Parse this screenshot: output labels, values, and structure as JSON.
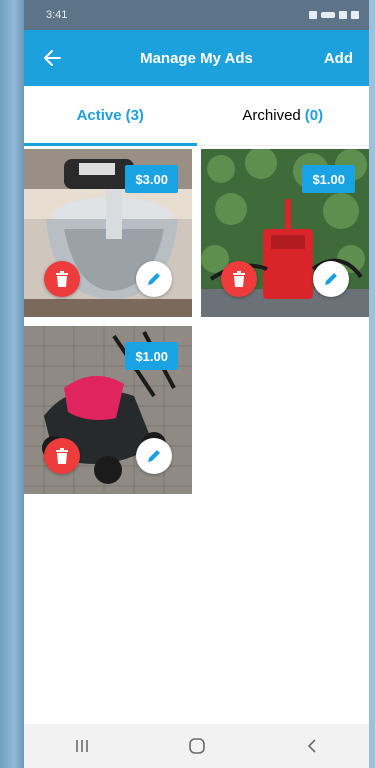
{
  "status_bar": {
    "time": "3:41"
  },
  "header": {
    "title": "Manage My Ads",
    "add_label": "Add",
    "back_icon": "arrow-left-icon"
  },
  "tabs": [
    {
      "label": "Active",
      "count": "(3)",
      "selected": true
    },
    {
      "label": "Archived",
      "count": "(0)",
      "selected": false
    }
  ],
  "ads": [
    {
      "price": "$3.00",
      "subject": "stand mixer"
    },
    {
      "price": "$1.00",
      "subject": "pressure washer"
    },
    {
      "price": "$1.00",
      "subject": "lawn mower"
    }
  ],
  "colors": {
    "accent": "#1da1dc",
    "delete": "#ee3b3b",
    "price_tag": "#1aa3e4"
  },
  "nav_bar": {
    "icons": [
      "recent-apps-icon",
      "home-icon",
      "back-nav-icon"
    ]
  }
}
